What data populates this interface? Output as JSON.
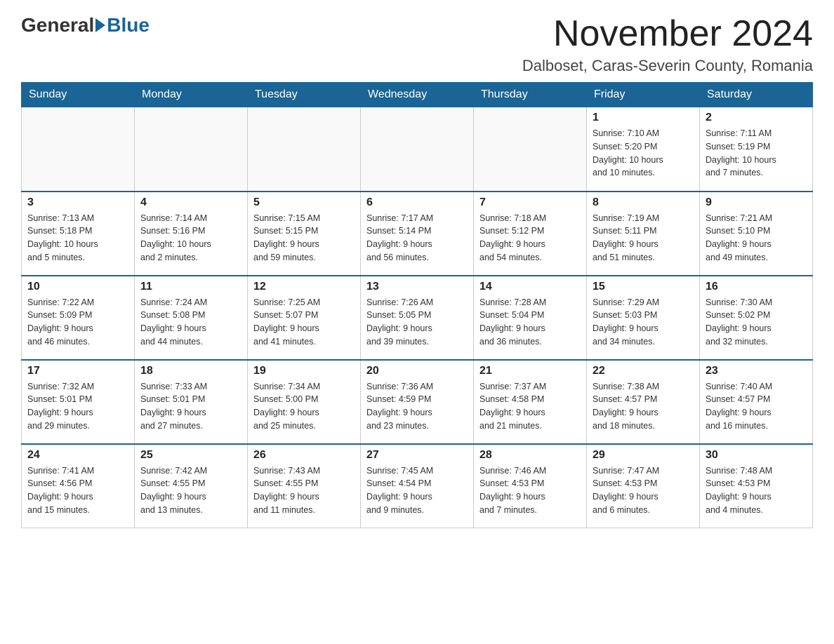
{
  "logo": {
    "general": "General",
    "blue": "Blue"
  },
  "title": {
    "month_year": "November 2024",
    "location": "Dalboset, Caras-Severin County, Romania"
  },
  "weekdays": [
    "Sunday",
    "Monday",
    "Tuesday",
    "Wednesday",
    "Thursday",
    "Friday",
    "Saturday"
  ],
  "weeks": [
    [
      {
        "day": "",
        "info": ""
      },
      {
        "day": "",
        "info": ""
      },
      {
        "day": "",
        "info": ""
      },
      {
        "day": "",
        "info": ""
      },
      {
        "day": "",
        "info": ""
      },
      {
        "day": "1",
        "info": "Sunrise: 7:10 AM\nSunset: 5:20 PM\nDaylight: 10 hours\nand 10 minutes."
      },
      {
        "day": "2",
        "info": "Sunrise: 7:11 AM\nSunset: 5:19 PM\nDaylight: 10 hours\nand 7 minutes."
      }
    ],
    [
      {
        "day": "3",
        "info": "Sunrise: 7:13 AM\nSunset: 5:18 PM\nDaylight: 10 hours\nand 5 minutes."
      },
      {
        "day": "4",
        "info": "Sunrise: 7:14 AM\nSunset: 5:16 PM\nDaylight: 10 hours\nand 2 minutes."
      },
      {
        "day": "5",
        "info": "Sunrise: 7:15 AM\nSunset: 5:15 PM\nDaylight: 9 hours\nand 59 minutes."
      },
      {
        "day": "6",
        "info": "Sunrise: 7:17 AM\nSunset: 5:14 PM\nDaylight: 9 hours\nand 56 minutes."
      },
      {
        "day": "7",
        "info": "Sunrise: 7:18 AM\nSunset: 5:12 PM\nDaylight: 9 hours\nand 54 minutes."
      },
      {
        "day": "8",
        "info": "Sunrise: 7:19 AM\nSunset: 5:11 PM\nDaylight: 9 hours\nand 51 minutes."
      },
      {
        "day": "9",
        "info": "Sunrise: 7:21 AM\nSunset: 5:10 PM\nDaylight: 9 hours\nand 49 minutes."
      }
    ],
    [
      {
        "day": "10",
        "info": "Sunrise: 7:22 AM\nSunset: 5:09 PM\nDaylight: 9 hours\nand 46 minutes."
      },
      {
        "day": "11",
        "info": "Sunrise: 7:24 AM\nSunset: 5:08 PM\nDaylight: 9 hours\nand 44 minutes."
      },
      {
        "day": "12",
        "info": "Sunrise: 7:25 AM\nSunset: 5:07 PM\nDaylight: 9 hours\nand 41 minutes."
      },
      {
        "day": "13",
        "info": "Sunrise: 7:26 AM\nSunset: 5:05 PM\nDaylight: 9 hours\nand 39 minutes."
      },
      {
        "day": "14",
        "info": "Sunrise: 7:28 AM\nSunset: 5:04 PM\nDaylight: 9 hours\nand 36 minutes."
      },
      {
        "day": "15",
        "info": "Sunrise: 7:29 AM\nSunset: 5:03 PM\nDaylight: 9 hours\nand 34 minutes."
      },
      {
        "day": "16",
        "info": "Sunrise: 7:30 AM\nSunset: 5:02 PM\nDaylight: 9 hours\nand 32 minutes."
      }
    ],
    [
      {
        "day": "17",
        "info": "Sunrise: 7:32 AM\nSunset: 5:01 PM\nDaylight: 9 hours\nand 29 minutes."
      },
      {
        "day": "18",
        "info": "Sunrise: 7:33 AM\nSunset: 5:01 PM\nDaylight: 9 hours\nand 27 minutes."
      },
      {
        "day": "19",
        "info": "Sunrise: 7:34 AM\nSunset: 5:00 PM\nDaylight: 9 hours\nand 25 minutes."
      },
      {
        "day": "20",
        "info": "Sunrise: 7:36 AM\nSunset: 4:59 PM\nDaylight: 9 hours\nand 23 minutes."
      },
      {
        "day": "21",
        "info": "Sunrise: 7:37 AM\nSunset: 4:58 PM\nDaylight: 9 hours\nand 21 minutes."
      },
      {
        "day": "22",
        "info": "Sunrise: 7:38 AM\nSunset: 4:57 PM\nDaylight: 9 hours\nand 18 minutes."
      },
      {
        "day": "23",
        "info": "Sunrise: 7:40 AM\nSunset: 4:57 PM\nDaylight: 9 hours\nand 16 minutes."
      }
    ],
    [
      {
        "day": "24",
        "info": "Sunrise: 7:41 AM\nSunset: 4:56 PM\nDaylight: 9 hours\nand 15 minutes."
      },
      {
        "day": "25",
        "info": "Sunrise: 7:42 AM\nSunset: 4:55 PM\nDaylight: 9 hours\nand 13 minutes."
      },
      {
        "day": "26",
        "info": "Sunrise: 7:43 AM\nSunset: 4:55 PM\nDaylight: 9 hours\nand 11 minutes."
      },
      {
        "day": "27",
        "info": "Sunrise: 7:45 AM\nSunset: 4:54 PM\nDaylight: 9 hours\nand 9 minutes."
      },
      {
        "day": "28",
        "info": "Sunrise: 7:46 AM\nSunset: 4:53 PM\nDaylight: 9 hours\nand 7 minutes."
      },
      {
        "day": "29",
        "info": "Sunrise: 7:47 AM\nSunset: 4:53 PM\nDaylight: 9 hours\nand 6 minutes."
      },
      {
        "day": "30",
        "info": "Sunrise: 7:48 AM\nSunset: 4:53 PM\nDaylight: 9 hours\nand 4 minutes."
      }
    ]
  ]
}
